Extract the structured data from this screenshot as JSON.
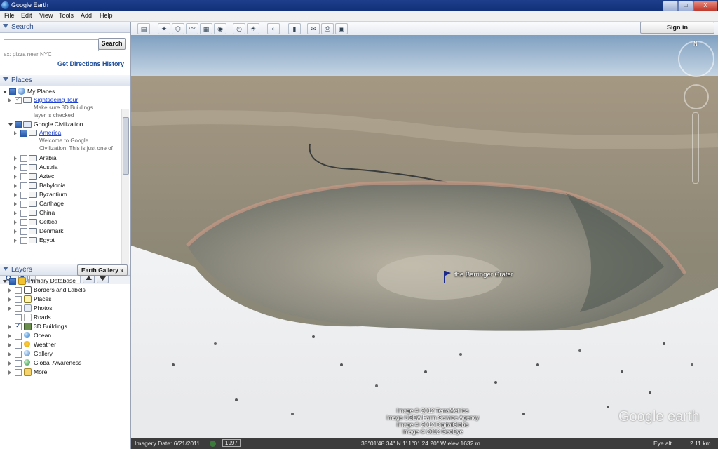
{
  "window": {
    "title": "Google Earth",
    "min": "_",
    "max": "□",
    "close": "X"
  },
  "menu": [
    "File",
    "Edit",
    "View",
    "Tools",
    "Add",
    "Help"
  ],
  "search": {
    "header": "Search",
    "input_value": "",
    "button": "Search",
    "hint": "ex: pizza near NYC",
    "get_directions": "Get Directions",
    "history": "History"
  },
  "places": {
    "header": "Places",
    "items": [
      {
        "label": "My Places"
      },
      {
        "label": "Sightseeing Tour",
        "sub1": "Make sure 3D Buildings",
        "sub2": "layer is checked"
      },
      {
        "label": "Google Civilization"
      },
      {
        "label": "America",
        "sub1": "Welcome to Google",
        "sub2": "Civilization! This is just one of"
      },
      {
        "label": "Arabia"
      },
      {
        "label": "Austria"
      },
      {
        "label": "Aztec"
      },
      {
        "label": "Babylonia"
      },
      {
        "label": "Byzantium"
      },
      {
        "label": "Carthage"
      },
      {
        "label": "China"
      },
      {
        "label": "Celtica"
      },
      {
        "label": "Denmark"
      },
      {
        "label": "Egypt"
      }
    ]
  },
  "layers": {
    "header": "Layers",
    "gallery_button": "Earth Gallery »",
    "items": [
      {
        "label": "Primary Database",
        "icon": "database-icon"
      },
      {
        "label": "Borders and Labels",
        "icon": "borders-icon"
      },
      {
        "label": "Places",
        "icon": "places-icon"
      },
      {
        "label": "Photos",
        "icon": "photos-icon"
      },
      {
        "label": "Roads",
        "icon": "roads-icon"
      },
      {
        "label": "3D Buildings",
        "icon": "buildings-icon"
      },
      {
        "label": "Ocean",
        "icon": "ocean-icon"
      },
      {
        "label": "Weather",
        "icon": "weather-icon"
      },
      {
        "label": "Gallery",
        "icon": "gallery-icon"
      },
      {
        "label": "Global Awareness",
        "icon": "global-icon"
      },
      {
        "label": "More",
        "icon": "more-icon"
      }
    ]
  },
  "toolbar": {
    "sign_in": "Sign in"
  },
  "map": {
    "placemark_label": "the Barringer Crater",
    "compass_n": "N",
    "credits": [
      "Image © 2012 TerraMetrics",
      "Image USDA Farm Service Agency",
      "Image © 2012 DigitalGlobe",
      "Image © 2012 GeoEye"
    ],
    "logo": "Google earth"
  },
  "status": {
    "imagery_date": "Imagery Date: 6/21/2011",
    "year": "1997",
    "coords": "35°01'48.34\" N  111°01'24.20\" W  elev  1632 m",
    "eye_alt": "Eye alt",
    "eye_alt_value": "2.11 km"
  },
  "colors": {
    "panel_header": "#2f4f8a",
    "titlebar": "#1e3e8c",
    "sky": "#b4cae0",
    "link": "#1a3fd1"
  }
}
